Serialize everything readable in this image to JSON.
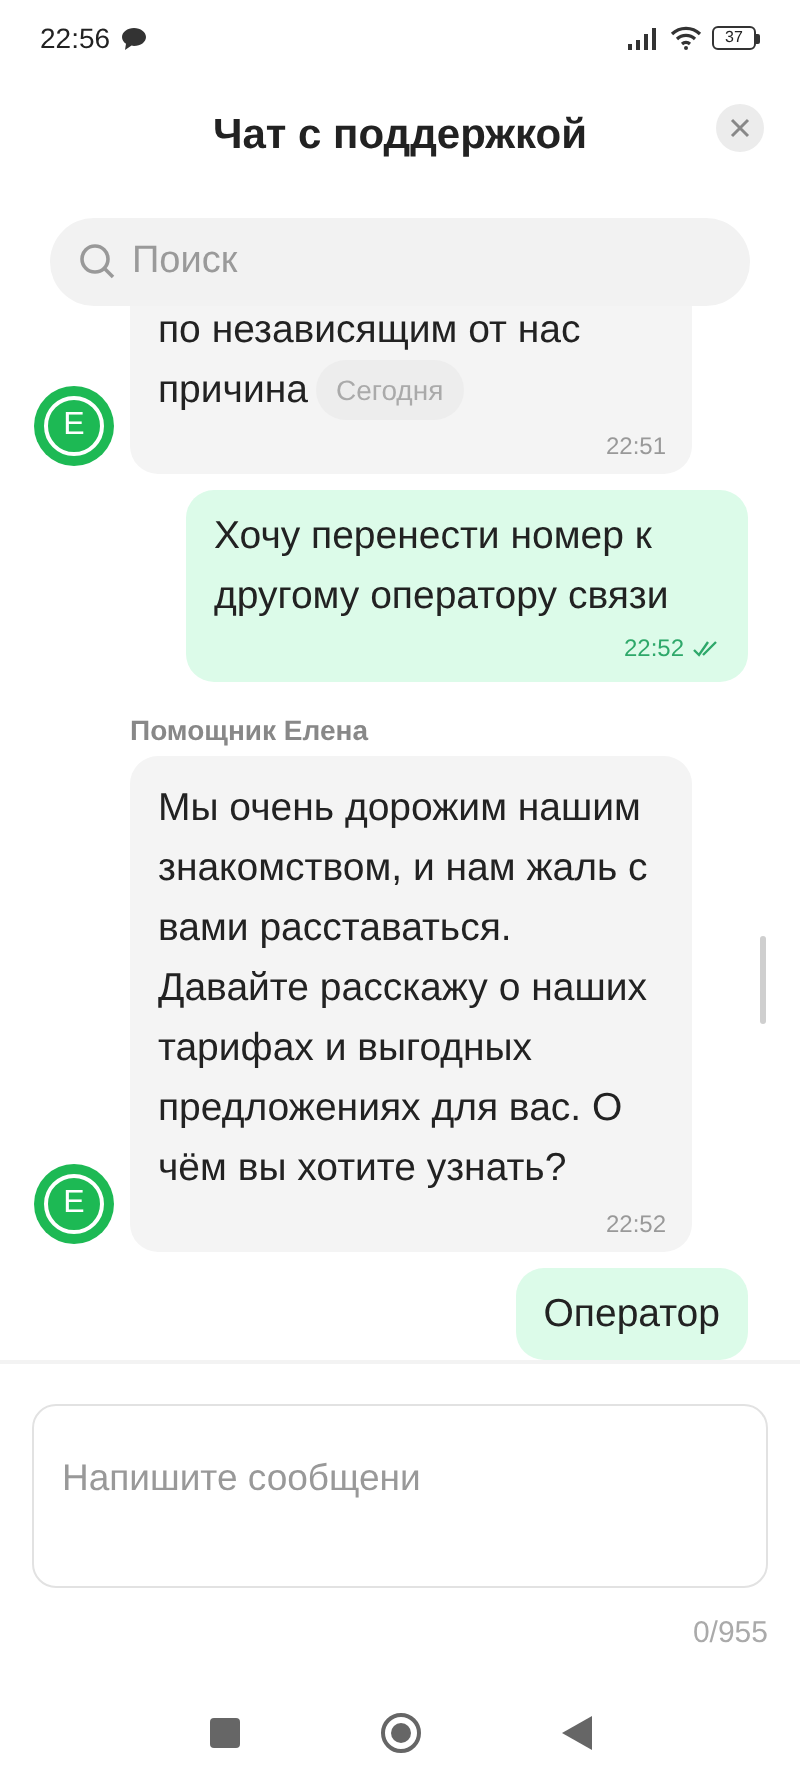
{
  "status_bar": {
    "time": "22:56",
    "battery": "37"
  },
  "header": {
    "title": "Чат с поддержкой"
  },
  "search": {
    "placeholder": "Поиск"
  },
  "date_chip": {
    "label": "Сегодня"
  },
  "messages": [
    {
      "kind": "incoming",
      "avatar": "E",
      "lines": [
        "по независящим от нас",
        "причина"
      ],
      "time": "22:51"
    },
    {
      "kind": "outgoing",
      "lines": [
        "Хочу перенести номер к другому оператору связи"
      ],
      "time": "22:52",
      "read": true
    },
    {
      "kind": "incoming",
      "avatar": "E",
      "sender": "Помощник Елена",
      "lines": [
        "Мы очень дорожим нашим знакомством, и нам жаль с вами расставаться. Давайте расскажу о наших тарифах и выгодных предложениях для вас. О чём вы хотите узнать?"
      ],
      "time": "22:52"
    },
    {
      "kind": "outgoing",
      "lines": [
        "Оператор"
      ]
    }
  ],
  "composer": {
    "placeholder": "Напишите сообщени",
    "counter": "0/955"
  }
}
